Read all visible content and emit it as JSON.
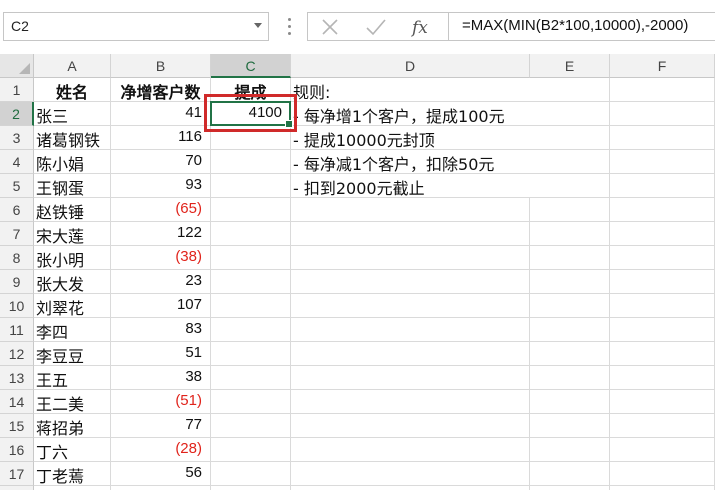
{
  "formula_bar": {
    "name_box": "C2",
    "cancel_icon": "x-icon",
    "enter_icon": "check-icon",
    "fx_label": "fx",
    "formula": "=MAX(MIN(B2*100,10000),-2000)"
  },
  "columns": [
    "A",
    "B",
    "C",
    "D",
    "E",
    "F"
  ],
  "selected_cell": "C2",
  "header_row": {
    "a": "姓名",
    "b": "净增客户数",
    "c": "提成",
    "d": "规则:"
  },
  "rows": [
    {
      "num": "2",
      "name": "张三",
      "value": "41",
      "c": "4100",
      "d": "- 每净增1个客户，提成100元",
      "negative": false
    },
    {
      "num": "3",
      "name": "诸葛钢铁",
      "value": "116",
      "c": "",
      "d": "- 提成10000元封顶",
      "negative": false
    },
    {
      "num": "4",
      "name": "陈小娟",
      "value": "70",
      "c": "",
      "d": "- 每净减1个客户，扣除50元",
      "negative": false
    },
    {
      "num": "5",
      "name": "王钢蛋",
      "value": "93",
      "c": "",
      "d": "- 扣到2000元截止",
      "negative": false
    },
    {
      "num": "6",
      "name": "赵铁锤",
      "value": "(65)",
      "c": "",
      "d": "",
      "negative": true
    },
    {
      "num": "7",
      "name": "宋大莲",
      "value": "122",
      "c": "",
      "d": "",
      "negative": false
    },
    {
      "num": "8",
      "name": "张小明",
      "value": "(38)",
      "c": "",
      "d": "",
      "negative": true
    },
    {
      "num": "9",
      "name": "张大发",
      "value": "23",
      "c": "",
      "d": "",
      "negative": false
    },
    {
      "num": "10",
      "name": "刘翠花",
      "value": "107",
      "c": "",
      "d": "",
      "negative": false
    },
    {
      "num": "11",
      "name": "李四",
      "value": "83",
      "c": "",
      "d": "",
      "negative": false
    },
    {
      "num": "12",
      "name": "李豆豆",
      "value": "51",
      "c": "",
      "d": "",
      "negative": false
    },
    {
      "num": "13",
      "name": "王五",
      "value": "38",
      "c": "",
      "d": "",
      "negative": false
    },
    {
      "num": "14",
      "name": "王二美",
      "value": "(51)",
      "c": "",
      "d": "",
      "negative": true
    },
    {
      "num": "15",
      "name": "蒋招弟",
      "value": "77",
      "c": "",
      "d": "",
      "negative": false
    },
    {
      "num": "16",
      "name": "丁六",
      "value": "(28)",
      "c": "",
      "d": "",
      "negative": true
    },
    {
      "num": "17",
      "name": "丁老蔫",
      "value": "56",
      "c": "",
      "d": "",
      "negative": false
    }
  ],
  "colors": {
    "accent": "#217346",
    "negative": "#e0231b",
    "highlight": "#d02a2a"
  }
}
